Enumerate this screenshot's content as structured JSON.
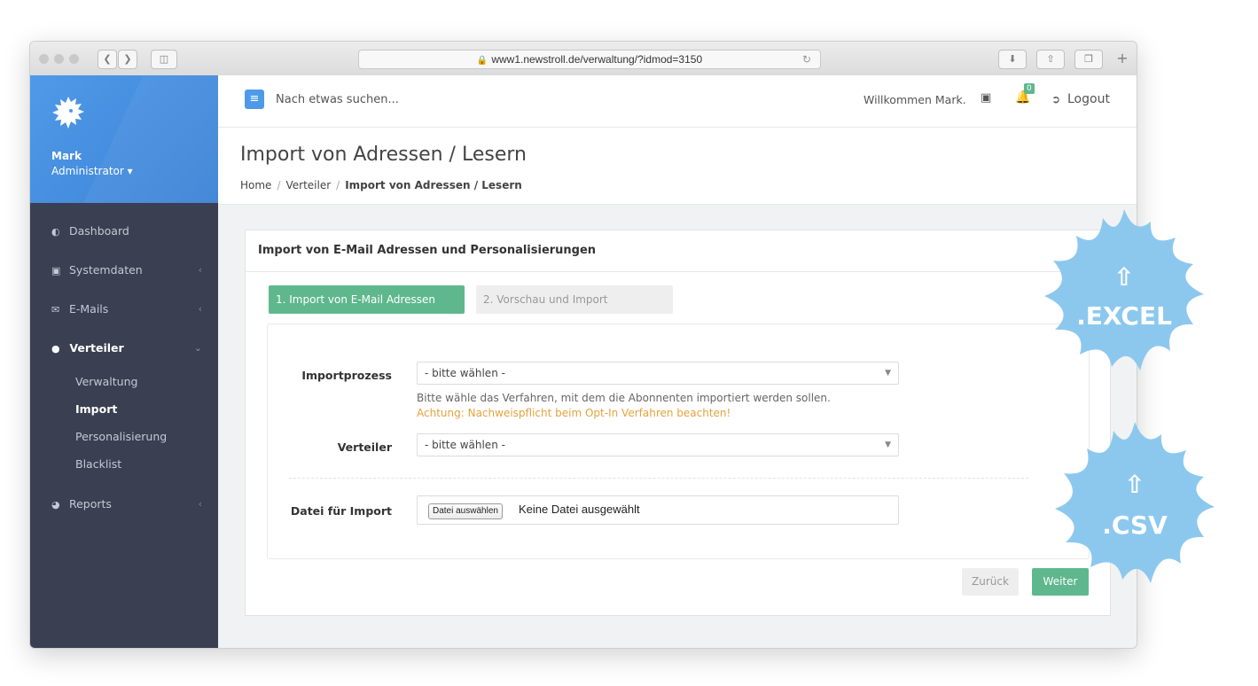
{
  "browser": {
    "url": "www1.newstroll.de/verwaltung/?idmod=3150"
  },
  "profile": {
    "name": "Mark",
    "role": "Administrator ▾"
  },
  "sidebar": {
    "items": [
      {
        "label": "Dashboard",
        "icon": "dashboard-icon"
      },
      {
        "label": "Systemdaten",
        "icon": "address-book-icon"
      },
      {
        "label": "E-Mails",
        "icon": "envelope-icon"
      },
      {
        "label": "Verteiler",
        "icon": "users-icon"
      },
      {
        "label": "Reports",
        "icon": "pie-chart-icon"
      }
    ],
    "subitems": [
      "Verwaltung",
      "Import",
      "Personalisierung",
      "Blacklist"
    ]
  },
  "topbar": {
    "search_placeholder": "Nach etwas suchen...",
    "welcome": "Willkommen Mark.",
    "notification_count": "0",
    "logout": "Logout"
  },
  "page": {
    "title": "Import von Adressen / Lesern",
    "breadcrumb": [
      "Home",
      "Verteiler",
      "Import von Adressen / Lesern"
    ]
  },
  "panel": {
    "title": "Import von E-Mail Adressen und Personalisierungen",
    "steps": [
      "1. Import von E-Mail Adressen",
      "2. Vorschau und Import"
    ],
    "importprozess": {
      "label": "Importprozess",
      "value": "- bitte wählen -",
      "help": "Bitte wähle das Verfahren, mit dem die Abonnenten importiert werden sollen.",
      "warning": "Achtung: Nachweispflicht beim Opt-In Verfahren beachten!"
    },
    "verteiler": {
      "label": "Verteiler",
      "value": "- bitte wählen -"
    },
    "datei": {
      "label": "Datei für Import",
      "button": "Datei auswählen",
      "status": "Keine Datei ausgewählt"
    },
    "buttons": {
      "back": "Zurück",
      "next": "Weiter"
    }
  },
  "badges": {
    "excel": ".EXCEL",
    "csv": ".CSV",
    "color": "#8cc8ee"
  },
  "colors": {
    "accent_blue": "#4f9ae8",
    "accent_green": "#5fb78e",
    "sidebar_bg": "#3a3f51",
    "warning": "#e6a23c"
  }
}
